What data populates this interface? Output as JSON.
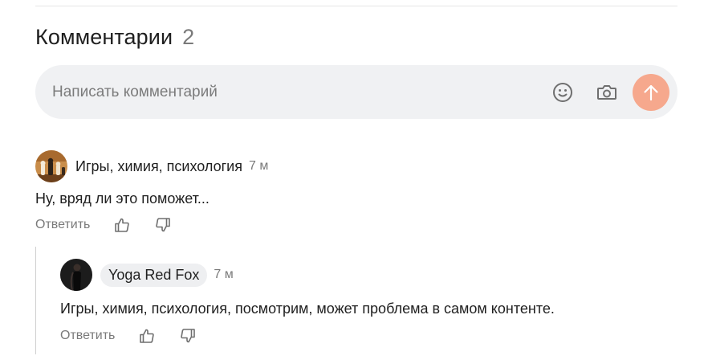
{
  "comments_section": {
    "title": "Комментарии",
    "count": "2"
  },
  "composer": {
    "placeholder": "Написать комментарий",
    "emoji_icon": "smiley-face-icon",
    "camera_icon": "camera-icon",
    "send_icon": "arrow-up-icon",
    "send_color": "#f6a88d"
  },
  "comments": [
    {
      "author": "Игры, химия, психология",
      "time": "7 м",
      "text": "Ну, вряд ли это поможет...",
      "reply_label": "Ответить",
      "avatar_icon": "chess-pieces-avatar"
    },
    {
      "author": "Yoga Red Fox",
      "time": "7 м",
      "text": "Игры, химия, психология, посмотрим, может проблема в самом контенте.",
      "reply_label": "Ответить",
      "avatar_icon": "person-silhouette-avatar"
    }
  ]
}
